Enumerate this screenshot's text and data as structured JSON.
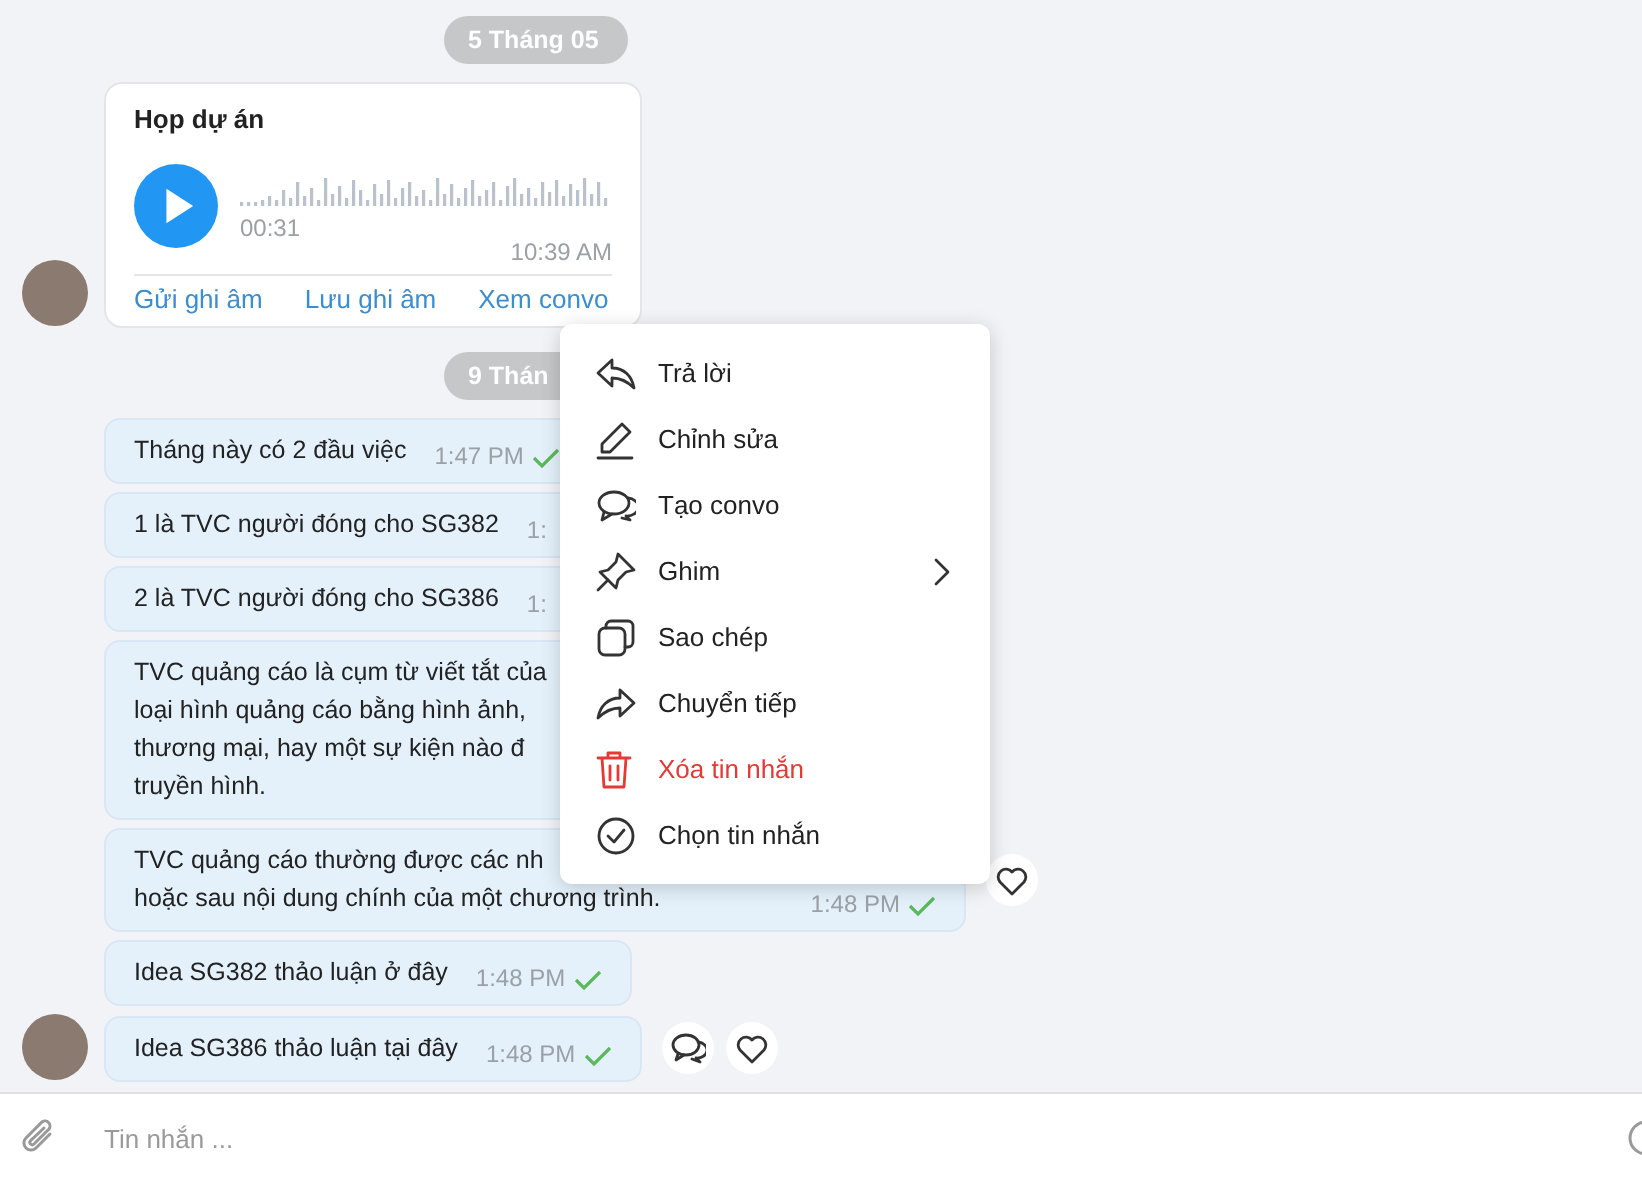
{
  "feed": [
    {
      "kind": "date",
      "label": "5 Tháng 05"
    },
    {
      "kind": "audio",
      "avatar": true,
      "title": "Họp dự án",
      "duration": "00:31",
      "time": "10:39 AM",
      "actions": [
        "Gửi ghi âm",
        "Lưu ghi âm",
        "Xem convo"
      ]
    },
    {
      "kind": "date",
      "label": "9 Thán"
    },
    {
      "kind": "text",
      "avatar": false,
      "lines": [
        "Tháng này có 2 đầu việc"
      ],
      "time": "1:47 PM",
      "check": true
    },
    {
      "kind": "text",
      "avatar": false,
      "lines": [
        "1 là TVC người đóng cho SG382"
      ],
      "time": "1:"
    },
    {
      "kind": "text",
      "avatar": false,
      "lines": [
        "2 là TVC người đóng cho SG386"
      ],
      "time": "1:"
    },
    {
      "kind": "text",
      "avatar": false,
      "lines": [
        "TVC quảng cáo là cụm từ viết tắt của",
        "loại hình quảng cáo bằng hình ảnh,",
        "thương mại, hay một sự kiện nào đ",
        "truyền hình."
      ]
    },
    {
      "kind": "text",
      "avatar": false,
      "lines": [
        "TVC quảng cáo thường được các nh",
        "hoặc sau nội dung chính của một chương trình."
      ],
      "time": "1:48 PM",
      "check": true,
      "reactions": [
        {
          "kind": "heart"
        }
      ]
    },
    {
      "kind": "text",
      "avatar": false,
      "lines": [
        "Idea SG382 thảo luận ở đây"
      ],
      "time": "1:48 PM",
      "check": true
    },
    {
      "kind": "text",
      "avatar": true,
      "lines": [
        "Idea SG386 thảo luận tại đây"
      ],
      "time": "1:48 PM",
      "check": true,
      "reactions": [
        {
          "kind": "comment"
        },
        {
          "kind": "heart"
        }
      ]
    }
  ],
  "context_menu": [
    {
      "kind": "reply",
      "label": "Trả lời",
      "danger": false,
      "submenu": false
    },
    {
      "kind": "edit",
      "label": "Chỉnh sửa",
      "danger": false,
      "submenu": false
    },
    {
      "kind": "convo",
      "label": "Tạo convo",
      "danger": false,
      "submenu": false
    },
    {
      "kind": "pin",
      "label": "Ghim",
      "danger": false,
      "submenu": true
    },
    {
      "kind": "copy",
      "label": "Sao chép",
      "danger": false,
      "submenu": false
    },
    {
      "kind": "forward",
      "label": "Chuyển tiếp",
      "danger": false,
      "submenu": false
    },
    {
      "kind": "delete",
      "label": "Xóa tin nhắn",
      "danger": true,
      "submenu": false
    },
    {
      "kind": "select",
      "label": "Chọn tin nhắn",
      "danger": false,
      "submenu": false
    }
  ],
  "composer": {
    "placeholder": "Tin nhắn ..."
  }
}
